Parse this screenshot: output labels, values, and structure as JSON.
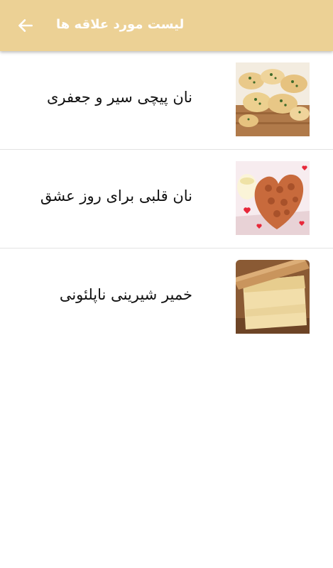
{
  "appbar": {
    "title": "لیست مورد علاقه ها",
    "back_icon": "arrow-left-icon"
  },
  "colors": {
    "appbar": "#ecd195",
    "title_text": "#ffffff",
    "item_text": "#111111",
    "divider": "#e2e2e2"
  },
  "favorites": [
    {
      "title": "نان پیچی سیر و جعفری",
      "image": "garlic-parsley-rolls-image"
    },
    {
      "title": "نان قلبی برای روز عشق",
      "image": "heart-bread-image"
    },
    {
      "title": "خمیر شیرینی ناپلئونی",
      "image": "puff-pastry-dough-image"
    }
  ]
}
